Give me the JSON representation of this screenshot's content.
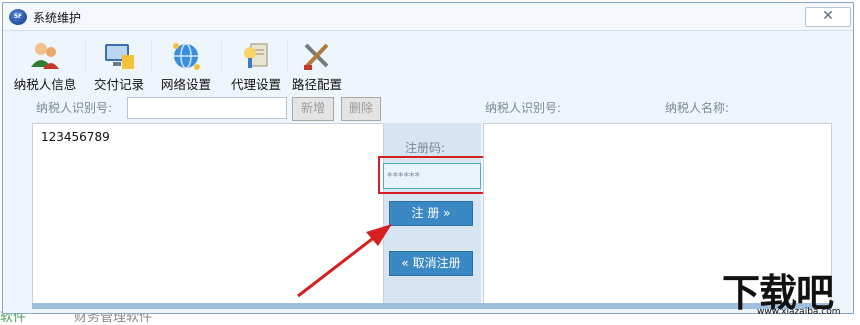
{
  "window": {
    "title": "系统维护",
    "logo_text": "5F",
    "close_symbol": "✕"
  },
  "toolbar": [
    {
      "label": "纳税人信息",
      "icon": "users-icon"
    },
    {
      "label": "交付记录",
      "icon": "computer-record-icon"
    },
    {
      "label": "网络设置",
      "icon": "globe-network-icon"
    },
    {
      "label": "代理设置",
      "icon": "proxy-pen-icon"
    },
    {
      "label": "路径配置",
      "icon": "tools-path-icon"
    }
  ],
  "form": {
    "taxid_label": "纳税人识别号:",
    "taxid_value": "",
    "add_button": "新增",
    "delete_button": "删除"
  },
  "left_list": {
    "items": [
      "123456789"
    ]
  },
  "registration": {
    "label": "注册码:",
    "value": "******",
    "register_button": "注 册 »",
    "unregister_button": "« 取消注册"
  },
  "right_table": {
    "col1_header": "纳税人识别号:",
    "col2_header": "纳税人名称:"
  },
  "background": {
    "text_left": "软件",
    "text_mid": "财务管理软件"
  },
  "watermark": {
    "main": "下载吧",
    "url": "www.xiazaiba.com"
  },
  "colors": {
    "highlight": "#d61f1f",
    "accent_button": "#3a88c4",
    "window_bg": "#eef5fc"
  }
}
